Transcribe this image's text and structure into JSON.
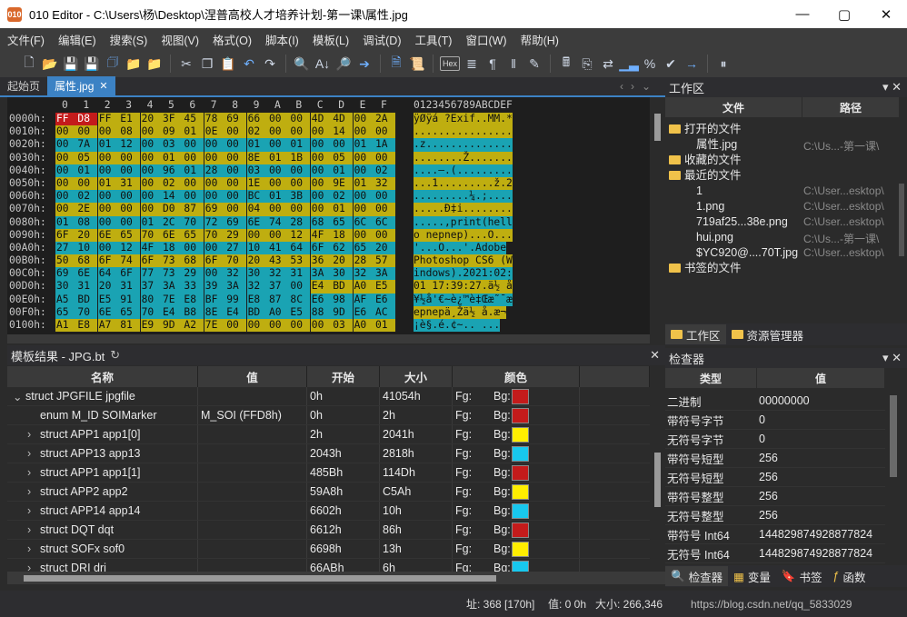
{
  "window": {
    "title": "010 Editor - C:\\Users\\杨\\Desktop\\涅普高校人才培养计划-第一课\\属性.jpg",
    "app_icon_label": "010"
  },
  "menu": [
    "文件(F)",
    "编辑(E)",
    "搜索(S)",
    "视图(V)",
    "格式(O)",
    "脚本(I)",
    "模板(L)",
    "调试(D)",
    "工具(T)",
    "窗口(W)",
    "帮助(H)"
  ],
  "tabs": {
    "start": "起始页",
    "file": "属性.jpg"
  },
  "toolbar": {
    "hex_label": "Hex"
  },
  "hex": {
    "col_header": [
      "0",
      "1",
      "2",
      "3",
      "4",
      "5",
      "6",
      "7",
      "8",
      "9",
      "A",
      "B",
      "C",
      "D",
      "E",
      "F"
    ],
    "ascii_header": "0123456789ABCDEF",
    "rows": [
      {
        "addr": "0000h:",
        "bytes": [
          "FF",
          "D8",
          "FF",
          "E1",
          "20",
          "3F",
          "45",
          "78",
          "69",
          "66",
          "00",
          "00",
          "4D",
          "4D",
          "00",
          "2A"
        ],
        "ascii": "ÿØÿá ?Exif..MM.*"
      },
      {
        "addr": "0010h:",
        "bytes": [
          "00",
          "00",
          "00",
          "08",
          "00",
          "09",
          "01",
          "0E",
          "00",
          "02",
          "00",
          "00",
          "00",
          "14",
          "00",
          "00"
        ],
        "ascii": "................"
      },
      {
        "addr": "0020h:",
        "bytes": [
          "00",
          "7A",
          "01",
          "12",
          "00",
          "03",
          "00",
          "00",
          "00",
          "01",
          "00",
          "01",
          "00",
          "00",
          "01",
          "1A"
        ],
        "ascii": ".z.............."
      },
      {
        "addr": "0030h:",
        "bytes": [
          "00",
          "05",
          "00",
          "00",
          "00",
          "01",
          "00",
          "00",
          "00",
          "8E",
          "01",
          "1B",
          "00",
          "05",
          "00",
          "00"
        ],
        "ascii": "........Ž......."
      },
      {
        "addr": "0040h:",
        "bytes": [
          "00",
          "01",
          "00",
          "00",
          "00",
          "96",
          "01",
          "28",
          "00",
          "03",
          "00",
          "00",
          "00",
          "01",
          "00",
          "02"
        ],
        "ascii": "....–.(........."
      },
      {
        "addr": "0050h:",
        "bytes": [
          "00",
          "00",
          "01",
          "31",
          "00",
          "02",
          "00",
          "00",
          "00",
          "1E",
          "00",
          "00",
          "00",
          "9E",
          "01",
          "32"
        ],
        "ascii": "...1.........ž.2"
      },
      {
        "addr": "0060h:",
        "bytes": [
          "00",
          "02",
          "00",
          "00",
          "00",
          "14",
          "00",
          "00",
          "00",
          "BC",
          "01",
          "3B",
          "00",
          "02",
          "00",
          "00"
        ],
        "ascii": ".........¼.;...."
      },
      {
        "addr": "0070h:",
        "bytes": [
          "00",
          "2E",
          "00",
          "00",
          "00",
          "D0",
          "87",
          "69",
          "00",
          "04",
          "00",
          "00",
          "00",
          "01",
          "00",
          "00"
        ],
        "ascii": ".....Ð‡i........"
      },
      {
        "addr": "0080h:",
        "bytes": [
          "01",
          "08",
          "00",
          "00",
          "01",
          "2C",
          "70",
          "72",
          "69",
          "6E",
          "74",
          "28",
          "68",
          "65",
          "6C",
          "6C"
        ],
        "ascii": ".....,print(hell"
      },
      {
        "addr": "0090h:",
        "bytes": [
          "6F",
          "20",
          "6E",
          "65",
          "70",
          "6E",
          "65",
          "70",
          "29",
          "00",
          "00",
          "12",
          "4F",
          "18",
          "00",
          "00"
        ],
        "ascii": "o nepnep)...O..."
      },
      {
        "addr": "00A0h:",
        "bytes": [
          "27",
          "10",
          "00",
          "12",
          "4F",
          "18",
          "00",
          "00",
          "27",
          "10",
          "41",
          "64",
          "6F",
          "62",
          "65",
          "20"
        ],
        "ascii": "'...O...'.Adobe "
      },
      {
        "addr": "00B0h:",
        "bytes": [
          "50",
          "68",
          "6F",
          "74",
          "6F",
          "73",
          "68",
          "6F",
          "70",
          "20",
          "43",
          "53",
          "36",
          "20",
          "28",
          "57"
        ],
        "ascii": "Photoshop CS6 (W"
      },
      {
        "addr": "00C0h:",
        "bytes": [
          "69",
          "6E",
          "64",
          "6F",
          "77",
          "73",
          "29",
          "00",
          "32",
          "30",
          "32",
          "31",
          "3A",
          "30",
          "32",
          "3A"
        ],
        "ascii": "indows).2021:02:"
      },
      {
        "addr": "00D0h:",
        "bytes": [
          "30",
          "31",
          "20",
          "31",
          "37",
          "3A",
          "33",
          "39",
          "3A",
          "32",
          "37",
          "00",
          "E4",
          "BD",
          "A0",
          "E5"
        ],
        "ascii": "01 17:39:27.ä½ å"
      },
      {
        "addr": "00E0h:",
        "bytes": [
          "A5",
          "BD",
          "E5",
          "91",
          "80",
          "7E",
          "E8",
          "BF",
          "99",
          "E8",
          "87",
          "8C",
          "E6",
          "98",
          "AF",
          "E6"
        ],
        "ascii": "¥½å'€~è¿™è‡Œæ˜¯æ"
      },
      {
        "addr": "00F0h:",
        "bytes": [
          "65",
          "70",
          "6E",
          "65",
          "70",
          "E4",
          "B8",
          "8E",
          "E4",
          "BD",
          "A0",
          "E5",
          "88",
          "9D",
          "E6",
          "AC"
        ],
        "ascii": "epnepä¸Žä½ å.æ¬"
      },
      {
        "addr": "0100h:",
        "bytes": [
          "A1",
          "E8",
          "A7",
          "81",
          "E9",
          "9D",
          "A2",
          "7E",
          "00",
          "00",
          "00",
          "00",
          "00",
          "03",
          "A0",
          "01"
        ],
        "ascii": "¡è§.é.¢~.. ... "
      }
    ]
  },
  "template": {
    "title": "模板结果 - JPG.bt",
    "headers": {
      "name": "名称",
      "value": "值",
      "start": "开始",
      "size": "大小",
      "color": "颜色"
    },
    "rows": [
      {
        "name": "struct JPGFILE jpgfile",
        "value": "",
        "start": "0h",
        "size": "41054h",
        "fg": "Fg:",
        "bg": "Bg:",
        "color": "#c41b1b",
        "indent": 0,
        "expand": "⌄"
      },
      {
        "name": "enum M_ID SOIMarker",
        "value": "M_SOI (FFD8h)",
        "start": "0h",
        "size": "2h",
        "fg": "Fg:",
        "bg": "Bg:",
        "color": "#c41b1b",
        "indent": 1,
        "expand": ""
      },
      {
        "name": "struct APP1 app1[0]",
        "value": "",
        "start": "2h",
        "size": "2041h",
        "fg": "Fg:",
        "bg": "Bg:",
        "color": "#ffee00",
        "indent": 1,
        "expand": "›"
      },
      {
        "name": "struct APP13 app13",
        "value": "",
        "start": "2043h",
        "size": "2818h",
        "fg": "Fg:",
        "bg": "Bg:",
        "color": "#18c8ee",
        "indent": 1,
        "expand": "›"
      },
      {
        "name": "struct APP1 app1[1]",
        "value": "",
        "start": "485Bh",
        "size": "114Dh",
        "fg": "Fg:",
        "bg": "Bg:",
        "color": "#c41b1b",
        "indent": 1,
        "expand": "›"
      },
      {
        "name": "struct APP2 app2",
        "value": "",
        "start": "59A8h",
        "size": "C5Ah",
        "fg": "Fg:",
        "bg": "Bg:",
        "color": "#ffee00",
        "indent": 1,
        "expand": "›"
      },
      {
        "name": "struct APP14 app14",
        "value": "",
        "start": "6602h",
        "size": "10h",
        "fg": "Fg:",
        "bg": "Bg:",
        "color": "#18c8ee",
        "indent": 1,
        "expand": "›"
      },
      {
        "name": "struct DQT dqt",
        "value": "",
        "start": "6612h",
        "size": "86h",
        "fg": "Fg:",
        "bg": "Bg:",
        "color": "#c41b1b",
        "indent": 1,
        "expand": "›"
      },
      {
        "name": "struct SOFx sof0",
        "value": "",
        "start": "6698h",
        "size": "13h",
        "fg": "Fg:",
        "bg": "Bg:",
        "color": "#ffee00",
        "indent": 1,
        "expand": "›"
      },
      {
        "name": "struct DRI dri",
        "value": "",
        "start": "66ABh",
        "size": "6h",
        "fg": "Fg:",
        "bg": "Bg:",
        "color": "#18c8ee",
        "indent": 1,
        "expand": "›"
      }
    ]
  },
  "workspace": {
    "title": "工作区",
    "headers": {
      "file": "文件",
      "path": "路径"
    },
    "items": [
      {
        "label": "打开的文件",
        "path": "",
        "kind": "folder",
        "indent": 0
      },
      {
        "label": "属性.jpg",
        "path": "C:\\Us...-第一课\\",
        "kind": "file",
        "indent": 1
      },
      {
        "label": "收藏的文件",
        "path": "",
        "kind": "folder",
        "indent": 0
      },
      {
        "label": "最近的文件",
        "path": "",
        "kind": "folder",
        "indent": 0
      },
      {
        "label": "1",
        "path": "C:\\User...esktop\\",
        "kind": "file",
        "indent": 1
      },
      {
        "label": "1.png",
        "path": "C:\\User...esktop\\",
        "kind": "file",
        "indent": 1
      },
      {
        "label": "719af25...38e.png",
        "path": "C:\\User...esktop\\",
        "kind": "file",
        "indent": 1
      },
      {
        "label": "hui.png",
        "path": "C:\\Us...-第一课\\",
        "kind": "file",
        "indent": 1
      },
      {
        "label": "$YC920@....70T.jpg",
        "path": "C:\\User...esktop\\",
        "kind": "file",
        "indent": 1
      },
      {
        "label": "书签的文件",
        "path": "",
        "kind": "folder",
        "indent": 0
      }
    ],
    "tabs": [
      "工作区",
      "资源管理器"
    ]
  },
  "inspector": {
    "title": "检查器",
    "headers": {
      "type": "类型",
      "value": "值"
    },
    "rows": [
      {
        "type": "二进制",
        "value": "00000000"
      },
      {
        "type": "带符号字节",
        "value": "0"
      },
      {
        "type": "无符号字节",
        "value": "0"
      },
      {
        "type": "带符号短型",
        "value": "256"
      },
      {
        "type": "无符号短型",
        "value": "256"
      },
      {
        "type": "带符号整型",
        "value": "256"
      },
      {
        "type": "无符号整型",
        "value": "256"
      },
      {
        "type": "带符号 Int64",
        "value": "144829874928877824"
      },
      {
        "type": "无符号 Int64",
        "value": "144829874928877824"
      }
    ],
    "tabs": [
      "检查器",
      "变量",
      "书签",
      "函数"
    ]
  },
  "status": {
    "address": "址: 368 [170h]",
    "value": "值: 0 0h",
    "size": "大小: 266,346",
    "overlay": "https://blog.csdn.net/qq_5833029"
  }
}
